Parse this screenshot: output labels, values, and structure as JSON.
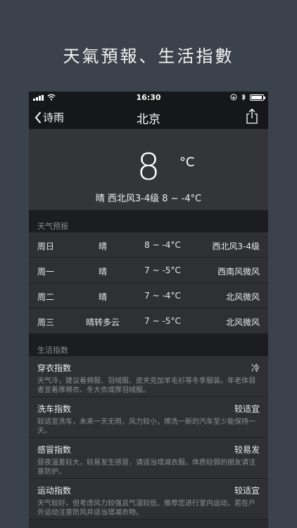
{
  "promo": {
    "title": "天氣預報、生活指數"
  },
  "statusbar": {
    "time": "16:30"
  },
  "navbar": {
    "back_label": "诗雨",
    "title": "北京"
  },
  "current": {
    "temperature": "8",
    "unit": "°C",
    "summary": "晴 西北风3-4级 8 ~ -4°C"
  },
  "forecast": {
    "header": "天气预报",
    "rows": [
      {
        "day": "周日",
        "condition": "晴",
        "temp": "8 ~ -4°C",
        "wind": "西北风3-4级"
      },
      {
        "day": "周一",
        "condition": "晴",
        "temp": "7 ~ -5°C",
        "wind": "西南风微风"
      },
      {
        "day": "周二",
        "condition": "晴",
        "temp": "7 ~ -4°C",
        "wind": "北风微风"
      },
      {
        "day": "周三",
        "condition": "晴转多云",
        "temp": "7 ~ -5°C",
        "wind": "北风微风"
      }
    ]
  },
  "life": {
    "header": "生活指数",
    "items": [
      {
        "name": "穿衣指数",
        "value": "冷",
        "desc": "天气冷，建议着棉服、羽绒服、皮夹克加羊毛衫等冬季服装。年老体弱者宜着厚棉衣、冬大衣或厚羽绒服。"
      },
      {
        "name": "洗车指数",
        "value": "较适宜",
        "desc": "较适宜洗车，未来一天无雨，风力较小，擦洗一新的汽车至少能保持一天。"
      },
      {
        "name": "感冒指数",
        "value": "较易发",
        "desc": "昼夜温差较大，较易发生感冒，请适当增减衣服。体质较弱的朋友请注意防护。"
      },
      {
        "name": "运动指数",
        "value": "较适宜",
        "desc": "天气较好，但考虑风力较强且气温较低，推荐您进行室内运动，若在户外运动注意防风并适当增减衣物。"
      }
    ]
  },
  "colors": {
    "background": "#3b424c",
    "panel": "#2f3033",
    "header": "#1c1d20"
  },
  "icons": {
    "back": "chevron-left-icon",
    "share": "share-icon",
    "wifi": "wifi-icon",
    "battery": "battery-icon",
    "bluetooth": "bluetooth-icon",
    "lock": "rotation-lock-icon"
  }
}
